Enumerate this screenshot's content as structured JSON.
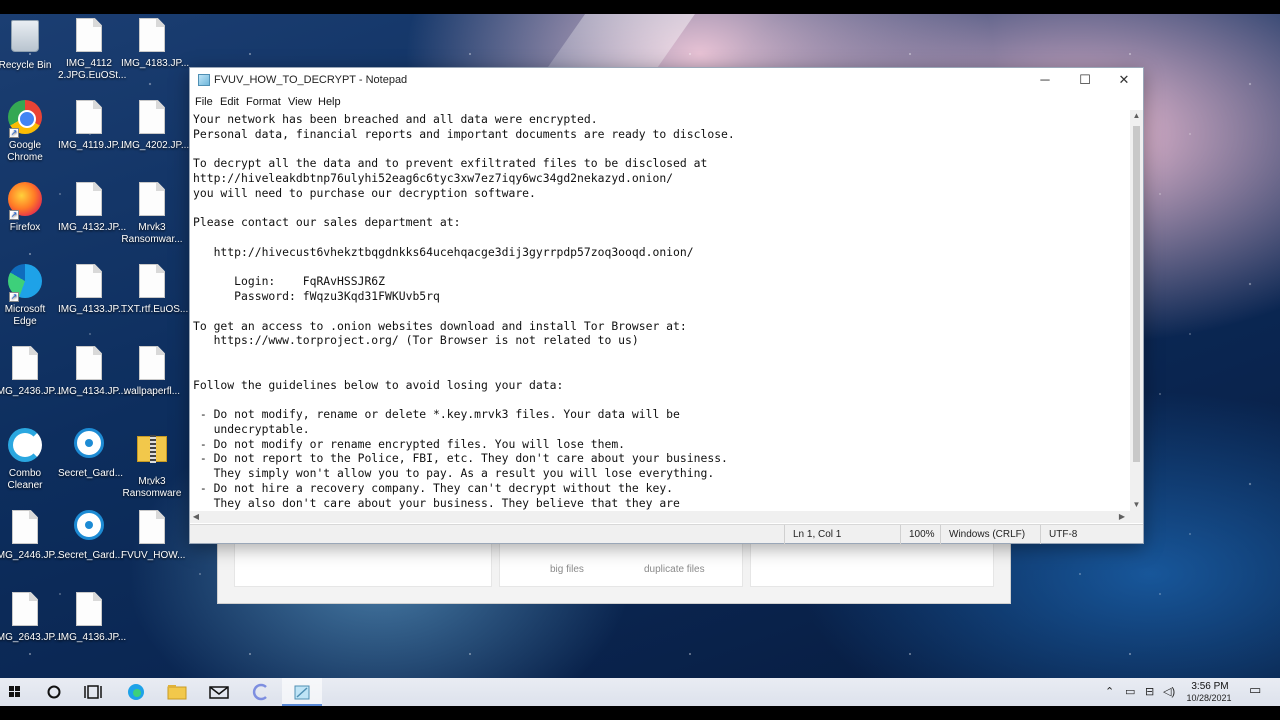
{
  "desktop_icons": [
    {
      "label": "Recycle Bin"
    },
    {
      "label": "IMG_4112\n2.JPG.EuOSt..."
    },
    {
      "label": "IMG_4183.JP..."
    },
    {
      "label": "Google\nChrome"
    },
    {
      "label": "IMG_4119.JP..."
    },
    {
      "label": "IMG_4202.JP..."
    },
    {
      "label": "Firefox"
    },
    {
      "label": "IMG_4132.JP..."
    },
    {
      "label": "Mrvk3\nRansomwar..."
    },
    {
      "label": "Microsoft\nEdge"
    },
    {
      "label": "IMG_4133.JP..."
    },
    {
      "label": "TXT.rtf.EuOS..."
    },
    {
      "label": "IMG_2436.JP..."
    },
    {
      "label": "IMG_4134.JP..."
    },
    {
      "label": "wallpaperfl..."
    },
    {
      "label": "Combo\nCleaner"
    },
    {
      "label": "Secret_Gard..."
    },
    {
      "label": "Mrvk3\nRansomware"
    },
    {
      "label": "IMG_2446.JP..."
    },
    {
      "label": "Secret_Gard..."
    },
    {
      "label": "FVUV_HOW..."
    },
    {
      "label": "IMG_2643.JP..."
    },
    {
      "label": "IMG_4136.JP..."
    }
  ],
  "background_window": {
    "label_big_files": "big files",
    "label_duplicate_files": "duplicate files"
  },
  "notepad": {
    "title": "FVUV_HOW_TO_DECRYPT - Notepad",
    "window_controls": {
      "minimize": "─",
      "maximize": "☐",
      "close": "✕"
    },
    "menu": [
      "File",
      "Edit",
      "Format",
      "View",
      "Help"
    ],
    "lines": [
      "Your network has been breached and all data were encrypted.",
      "Personal data, financial reports and important documents are ready to disclose.",
      "",
      "To decrypt all the data and to prevent exfiltrated files to be disclosed at",
      "http://hiveleakdbtnp76ulyhi52eag6c6tyc3xw7ez7iqy6wc34gd2nekazyd.onion/",
      "you will need to purchase our decryption software.",
      "",
      "Please contact our sales department at:",
      "",
      "   http://hivecust6vhekztbqgdnkks64ucehqacge3dij3gyrrpdp57zoq3ooqd.onion/",
      "",
      "      Login:    FqRAvHSSJR6Z",
      "      Password: fWqzu3Kqd31FWKUvb5rq",
      "",
      "To get an access to .onion websites download and install Tor Browser at:",
      "   https://www.torproject.org/ (Tor Browser is not related to us)",
      "",
      "",
      "Follow the guidelines below to avoid losing your data:",
      "",
      " - Do not modify, rename or delete *.key.mrvk3 files. Your data will be",
      "   undecryptable.",
      " - Do not modify or rename encrypted files. You will lose them.",
      " - Do not report to the Police, FBI, etc. They don't care about your business.",
      "   They simply won't allow you to pay. As a result you will lose everything.",
      " - Do not hire a recovery company. They can't decrypt without the key.",
      "   They also don't care about your business. They believe that they are"
    ],
    "status": {
      "position": "Ln 1, Col 1",
      "zoom": "100%",
      "line_ending": "Windows (CRLF)",
      "encoding": "UTF-8"
    }
  },
  "taskbar": {
    "time": "3:56 PM",
    "date": "10/28/2021"
  }
}
